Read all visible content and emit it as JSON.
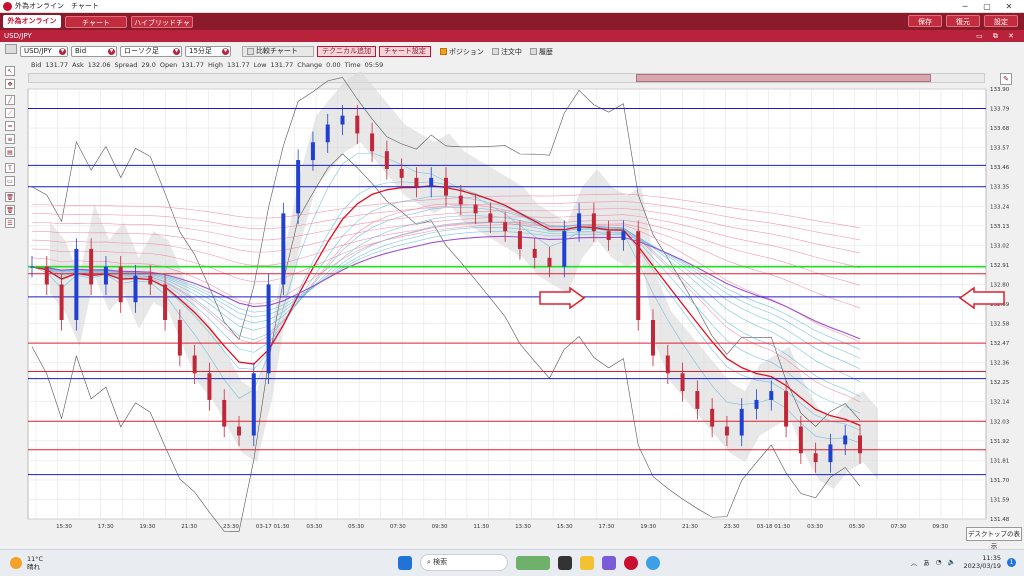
{
  "window": {
    "title": "外為オンライン　チャート",
    "minimize": "─",
    "maximize": "▢",
    "close": "✕"
  },
  "menu": {
    "brand": "外為オンライン",
    "chart_btn": "チャート",
    "hybrid_btn": "ハイブリッドチャート",
    "save": "保存",
    "restore": "復元",
    "settings": "設定"
  },
  "pane": {
    "symbol": "USD/JPY",
    "controls": "▭ ⧉ ✕"
  },
  "toolbar": {
    "pair": "USD/JPY",
    "side": "Bid",
    "ctype": "ローソク足",
    "period": "15分足",
    "compare": "比較チャート",
    "tech": "テクニカル追加",
    "chart_set": "チャート設定",
    "position": "ポジション",
    "orders": "注文中",
    "history": "履歴"
  },
  "info": [
    {
      "k": "Bid",
      "v": "131.77"
    },
    {
      "k": "Ask",
      "v": "132.06"
    },
    {
      "k": "Spread",
      "v": "29.0"
    },
    {
      "k": "Open",
      "v": "131.77"
    },
    {
      "k": "High",
      "v": "131.77"
    },
    {
      "k": "Low",
      "v": "131.77"
    },
    {
      "k": "Change",
      "v": "0.00"
    },
    {
      "k": "Time",
      "v": "05:59"
    }
  ],
  "chart_data": {
    "type": "candlestick",
    "ylim": [
      131.48,
      133.9
    ],
    "yticks": [
      "133.90",
      "133.79",
      "133.68",
      "133.57",
      "133.46",
      "133.35",
      "133.24",
      "133.13",
      "133.02",
      "132.91",
      "132.80",
      "132.69",
      "132.58",
      "132.47",
      "132.36",
      "132.25",
      "132.14",
      "132.03",
      "131.92",
      "131.81",
      "131.70",
      "131.59",
      "131.48"
    ],
    "xticks": [
      "15:30",
      "17:30",
      "19:30",
      "21:30",
      "23:30",
      "03-17 01:30",
      "03:30",
      "05:30",
      "07:30",
      "09:30",
      "11:30",
      "13:30",
      "15:30",
      "17:30",
      "19:30",
      "21:30",
      "23:30",
      "03-18 01:30",
      "03:30",
      "05:30",
      "07:30",
      "09:30"
    ],
    "closes": [
      132.9,
      132.8,
      132.6,
      133.0,
      132.8,
      132.9,
      132.7,
      132.85,
      132.8,
      132.6,
      132.4,
      132.3,
      132.15,
      132.0,
      131.95,
      132.3,
      132.8,
      133.2,
      133.5,
      133.6,
      133.7,
      133.75,
      133.65,
      133.55,
      133.45,
      133.4,
      133.35,
      133.4,
      133.3,
      133.25,
      133.2,
      133.15,
      133.1,
      133.0,
      132.95,
      132.9,
      133.1,
      133.2,
      133.1,
      133.05,
      133.1,
      132.6,
      132.4,
      132.3,
      132.2,
      132.1,
      132.0,
      131.95,
      132.1,
      132.15,
      132.2,
      132.0,
      131.85,
      131.8,
      131.9,
      131.95,
      131.85
    ],
    "horizontal_levels": [
      133.79,
      133.47,
      133.35,
      132.86,
      132.73,
      132.47,
      132.31,
      132.27,
      132.03,
      131.87,
      131.73
    ],
    "green_level": 132.9,
    "colors": {
      "up": "#2040d0",
      "down": "#c0283a",
      "grid": "#e6e6e6",
      "level": "#1a1acc",
      "green": "#22dd22",
      "ema_red": "#e01020",
      "purple": "#a050d0"
    }
  },
  "taskbar": {
    "temp": "11°C",
    "weather": "晴れ",
    "search": "検索",
    "ime": "あ",
    "time": "11:35",
    "date": "2023/03/19",
    "badge": "1"
  },
  "tooltip": "デスクトップの表示"
}
